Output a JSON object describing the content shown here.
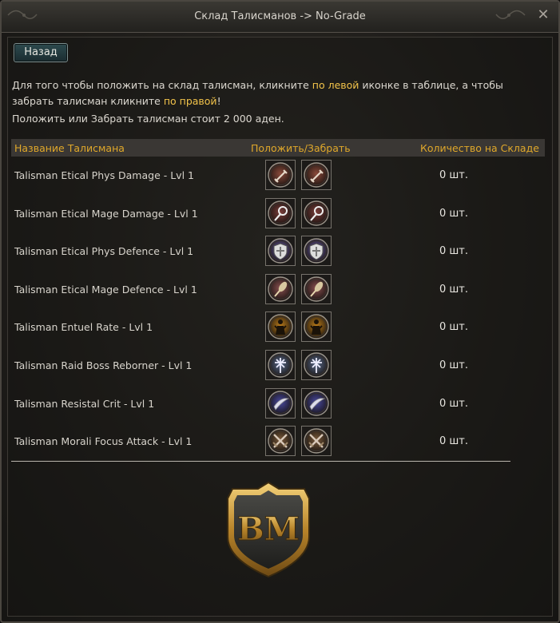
{
  "window": {
    "title": "Склад Талисманов -> No-Grade",
    "close_glyph": "✕"
  },
  "back_label": "Назад",
  "info": {
    "p1_a": "Для того чтобы положить на склад талисман, кликните ",
    "p1_hl1": "по левой",
    "p1_b": " иконке в таблице, а чтобы",
    "p2_a": "забрать талисман кликните ",
    "p2_hl2": "по правой",
    "p2_b": "!",
    "p3": "Положить или Забрать талисман стоит 2 000 аден.",
    "highlight_color": "#f2c34a"
  },
  "table": {
    "headers": {
      "name": "Название Талисмана",
      "action": "Положить/Забрать",
      "qty": "Количество на Складе"
    },
    "rows": [
      {
        "name": "Talisman Etical Phys Damage - Lvl 1",
        "qty": "0 шт.",
        "icon": "sword-icon",
        "color": "#8a4a3a"
      },
      {
        "name": "Talisman Etical Mage Damage - Lvl 1",
        "qty": "0 шт.",
        "icon": "staff-icon",
        "color": "#7a3e3a"
      },
      {
        "name": "Talisman Etical Phys Defence - Lvl 1",
        "qty": "0 шт.",
        "icon": "shield-icon",
        "color": "#6a5aa0"
      },
      {
        "name": "Talisman Etical Mage Defence - Lvl 1",
        "qty": "0 шт.",
        "icon": "feather-icon",
        "color": "#8a5050"
      },
      {
        "name": "Talisman Entuel Rate - Lvl 1",
        "qty": "0 шт.",
        "icon": "figure-icon",
        "color": "#b87a1a"
      },
      {
        "name": "Talisman Raid Boss Reborner - Lvl 1",
        "qty": "0 шт.",
        "icon": "cross-icon",
        "color": "#5a6a8a"
      },
      {
        "name": "Talisman Resistal Crit - Lvl 1",
        "qty": "0 шт.",
        "icon": "blade-icon",
        "color": "#4a4aa0"
      },
      {
        "name": "Talisman Morali Focus Attack - Lvl 1",
        "qty": "0 шт.",
        "icon": "crossed-swords-icon",
        "color": "#7a5a3a"
      }
    ]
  },
  "logo_text": "BM"
}
